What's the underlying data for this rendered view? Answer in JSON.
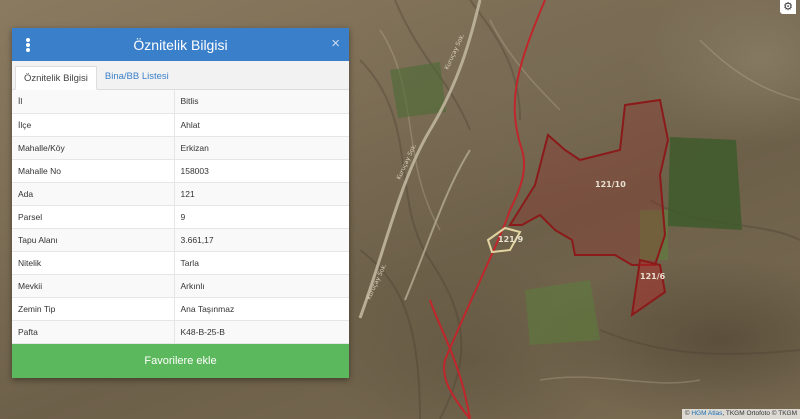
{
  "panel": {
    "title": "Öznitelik Bilgisi",
    "close": "×",
    "tabs": [
      {
        "label": "Öznitelik Bilgisi"
      },
      {
        "label": "Bina/BB Listesi"
      }
    ],
    "attributes": [
      {
        "key": "İl",
        "value": "Bitlis"
      },
      {
        "key": "İlçe",
        "value": "Ahlat"
      },
      {
        "key": "Mahalle/Köy",
        "value": "Erkizan"
      },
      {
        "key": "Mahalle No",
        "value": "158003"
      },
      {
        "key": "Ada",
        "value": "121"
      },
      {
        "key": "Parsel",
        "value": "9"
      },
      {
        "key": "Tapu Alanı",
        "value": "3.661,17"
      },
      {
        "key": "Nitelik",
        "value": "Tarla"
      },
      {
        "key": "Mevkii",
        "value": "Arkınlı"
      },
      {
        "key": "Zemin Tip",
        "value": "Ana Taşınmaz"
      },
      {
        "key": "Pafta",
        "value": "K48-B-25-B"
      }
    ],
    "favorite_button": "Favorilere ekle"
  },
  "map": {
    "parcel_labels": [
      "121/10",
      "121/9",
      "121/6"
    ],
    "road_labels": [
      "Kuruçay Sok.",
      "Kuruçay Sok.",
      "Kuruçay Sok."
    ],
    "settings_icon": "gear-icon",
    "attribution": {
      "prefix": "© ",
      "hgm": "HGM Atlas",
      "rest": ", TKGM Ortofoto © TKGM"
    },
    "colors": {
      "boundary": "#c0262b",
      "selected_parcel": "#e2d4a0",
      "panel_header": "#3a7fc9",
      "favorite_button": "#5cb85c"
    }
  }
}
